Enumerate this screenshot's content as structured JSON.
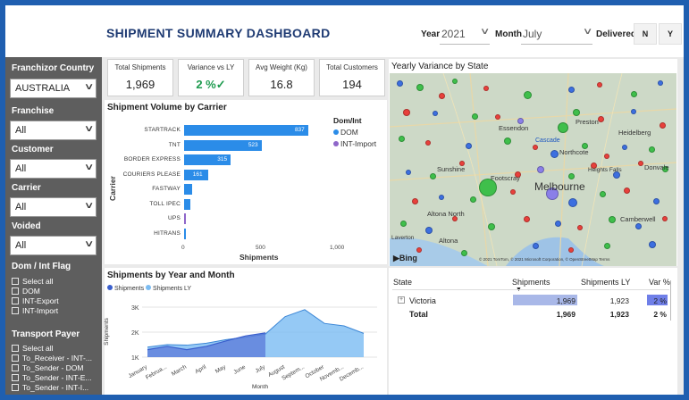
{
  "header": {
    "title": "SHIPMENT SUMMARY DASHBOARD",
    "year_label": "Year",
    "year_value": "2021",
    "month_label": "Month",
    "month_value": "July",
    "delivered_label": "Delivered",
    "delivered_options": [
      "N",
      "Y"
    ]
  },
  "sidebar": {
    "franchizor_country_label": "Franchizor Country",
    "franchizor_country_value": "AUSTRALIA",
    "franchise_label": "Franchise",
    "franchise_value": "All",
    "customer_label": "Customer",
    "customer_value": "All",
    "carrier_label": "Carrier",
    "carrier_value": "All",
    "voided_label": "Voided",
    "voided_value": "All",
    "dom_int_label": "Dom / Int Flag",
    "dom_int_options": [
      "Select all",
      "DOM",
      "INT-Export",
      "INT-Import"
    ],
    "transport_payer_label": "Transport Payer",
    "transport_payer_options": [
      "Select all",
      "To_Receiver - INT-...",
      "To_Sender - DOM",
      "To_Sender - INT-E...",
      "To_Sender - INT-I..."
    ]
  },
  "kpis": [
    {
      "label": "Total Shipments",
      "value": "1,969"
    },
    {
      "label": "Variance vs LY",
      "value": "2 %✓"
    },
    {
      "label": "Avg Weight (Kg)",
      "value": "16.8"
    },
    {
      "label": "Total Customers",
      "value": "194"
    }
  ],
  "map": {
    "title": "Yearly Variance by State",
    "places": [
      "Essendon",
      "Preston",
      "Heidelberg",
      "Cascade",
      "Northcote",
      "Sunshine",
      "Footscray",
      "Heights Falls",
      "Donvale",
      "Melbourne",
      "Altona North",
      "Altona",
      "Camberwell",
      "Laverton"
    ],
    "bing_logo": "Bing",
    "copyright": "© 2021 TomTom, © 2021 Microsoft Corporation, © OpenStreetMap Terms"
  },
  "chart_data": [
    {
      "type": "bar",
      "title": "Shipment Volume by Carrier",
      "xlabel": "Shipments",
      "ylabel": "Carrier",
      "legend_title": "Dom/Int",
      "legend_position": "right",
      "categories": [
        "STARTRACK",
        "TNT",
        "BORDER EXPRESS",
        "COURIERS PLEASE",
        "FASTWAY",
        "TOLL IPEC",
        "UPS",
        "HITRANS"
      ],
      "series": [
        {
          "name": "DOM",
          "color": "#2b8ce8",
          "values": [
            837,
            523,
            315,
            161,
            55,
            45,
            0,
            5
          ]
        },
        {
          "name": "INT-Import",
          "color": "#8e66c9",
          "values": [
            0,
            0,
            0,
            0,
            0,
            0,
            12,
            0
          ]
        }
      ],
      "data_labels": [
        "837",
        "523",
        "315",
        "161"
      ],
      "xticks": [
        "0",
        "500",
        "1,000"
      ],
      "xlim": [
        0,
        1000
      ]
    },
    {
      "type": "area",
      "title": "Shipments by Year and Month",
      "xlabel": "Month",
      "ylabel": "Shipments",
      "legend_position": "top-left",
      "x": [
        "January",
        "February",
        "March",
        "April",
        "May",
        "June",
        "July",
        "August",
        "September",
        "October",
        "November",
        "December"
      ],
      "series": [
        {
          "name": "Shipments",
          "color": "#3a5fcd",
          "values": [
            1300,
            1430,
            1300,
            1430,
            1650,
            1850,
            1969,
            null,
            null,
            null,
            null,
            null
          ]
        },
        {
          "name": "Shipments LY",
          "color": "#7bbcf2",
          "values": [
            1400,
            1500,
            1480,
            1560,
            1700,
            1800,
            1923,
            2620,
            2900,
            2350,
            2250,
            1950
          ]
        }
      ],
      "yticks": [
        "1K",
        "2K",
        "3K"
      ],
      "ylim": [
        1000,
        3000
      ]
    }
  ],
  "table": {
    "headers": [
      "State",
      "Shipments",
      "Shipments LY",
      "Var %"
    ],
    "rows": [
      {
        "state": "Victoria",
        "shipments": "1,969",
        "shipments_ly": "1,923",
        "var": "2 %"
      }
    ],
    "total": {
      "label": "Total",
      "shipments": "1,969",
      "shipments_ly": "1,923",
      "var": "2 %"
    }
  }
}
